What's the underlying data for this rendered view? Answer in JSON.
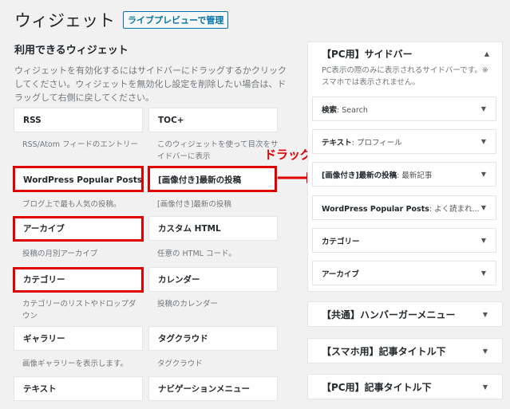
{
  "header": {
    "title": "ウィジェット",
    "manage_button": "ライブプレビューで管理"
  },
  "available": {
    "title": "利用できるウィジェット",
    "description": "ウィジェットを有効化するにはサイドバーにドラッグするかクリックしてください。ウィジェットを無効化し設定を削除したい場合は、ドラッグして右側に戻してください。"
  },
  "widgets": [
    {
      "name": "RSS",
      "desc": "RSS/Atom フィードのエントリー"
    },
    {
      "name": "TOC+",
      "desc": "このウィジェットを使って目次をサイドバーに表示"
    },
    {
      "name": "WordPress Popular Posts",
      "desc": "ブログ上で最も人気の投稿。"
    },
    {
      "name": "[画像付き]最新の投稿",
      "desc": "[画像付き]最新の投稿"
    },
    {
      "name": "アーカイブ",
      "desc": "投稿の月別アーカイブ"
    },
    {
      "name": "カスタム HTML",
      "desc": "任意の HTML コード。"
    },
    {
      "name": "カテゴリー",
      "desc": "カテゴリーのリストやドロップダウン"
    },
    {
      "name": "カレンダー",
      "desc": "投稿のカレンダー"
    },
    {
      "name": "ギャラリー",
      "desc": "画像ギャラリーを表示します。"
    },
    {
      "name": "タグクラウド",
      "desc": "タグクラウド"
    },
    {
      "name": "テキスト",
      "desc": ""
    },
    {
      "name": "ナビゲーションメニュー",
      "desc": ""
    }
  ],
  "annotation": {
    "drag_label": "ドラッグ",
    "highlight_color": "#e00000"
  },
  "sidebar": {
    "title": "【PC用】サイドバー",
    "description": "PC表示の際のみに表示されるサイドバーです。※スマホでは表示されません。",
    "items": [
      {
        "label": "検索",
        "sub": ": Search"
      },
      {
        "label": "テキスト",
        "sub": ": プロフィール"
      },
      {
        "label": "[画像付き]最新の投稿",
        "sub": ": 最新記事"
      },
      {
        "label": "WordPress Popular Posts",
        "sub": ": よく読まれ..."
      },
      {
        "label": "カテゴリー",
        "sub": ""
      },
      {
        "label": "アーカイブ",
        "sub": ""
      }
    ]
  },
  "areas": [
    {
      "title": "【共通】ハンバーガーメニュー"
    },
    {
      "title": "【スマホ用】記事タイトル下"
    },
    {
      "title": "【PC用】記事タイトル下"
    }
  ]
}
